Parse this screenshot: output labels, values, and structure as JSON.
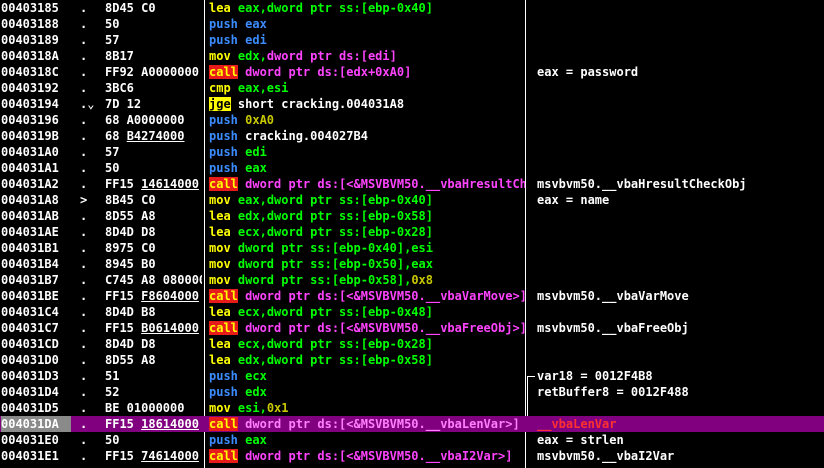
{
  "panel": "Disassembly",
  "rows": [
    {
      "addr": "00403185",
      "mark": ".",
      "bytes": "8D45 C0",
      "ops": [
        {
          "t": "lea",
          "c": "op-yellow"
        },
        {
          "t": " eax,",
          "c": "t-green"
        },
        {
          "t": "dword ptr ss:[ebp-0x40]",
          "c": "t-green"
        }
      ],
      "comment": ""
    },
    {
      "addr": "00403188",
      "mark": ".",
      "bytes": "50",
      "ops": [
        {
          "t": "push",
          "c": "op-blue"
        },
        {
          "t": " eax",
          "c": "op-blue"
        }
      ],
      "comment": ""
    },
    {
      "addr": "00403189",
      "mark": ".",
      "bytes": "57",
      "ops": [
        {
          "t": "push",
          "c": "op-blue"
        },
        {
          "t": " edi",
          "c": "op-blue"
        }
      ],
      "comment": ""
    },
    {
      "addr": "0040318A",
      "mark": ".",
      "bytes": "8B17",
      "ops": [
        {
          "t": "mov",
          "c": "op-yellow"
        },
        {
          "t": " edx,",
          "c": "t-green"
        },
        {
          "t": "dword ptr ds:[edi]",
          "c": "t-magenta"
        }
      ],
      "comment": ""
    },
    {
      "addr": "0040318C",
      "mark": ".",
      "bytes": "FF92 A0000000",
      "ops": [
        {
          "t": "call",
          "c": "op-callbox"
        },
        {
          "t": " dword ptr ds:[edx+0xA0]",
          "c": "t-magenta"
        }
      ],
      "comment": "eax = password"
    },
    {
      "addr": "00403192",
      "mark": ".",
      "bytes": "3BC6",
      "ops": [
        {
          "t": "cmp",
          "c": "op-yellow"
        },
        {
          "t": " eax,esi",
          "c": "t-green"
        }
      ],
      "comment": ""
    },
    {
      "addr": "00403194",
      "mark": ".⌄",
      "bytes": "7D 12",
      "ops": [
        {
          "t": "jge",
          "c": "op-jgebox"
        },
        {
          "t": " short cracking.004031A8",
          "c": "t-white"
        }
      ],
      "comment": ""
    },
    {
      "addr": "00403196",
      "mark": ".",
      "bytes": "68 A0000000",
      "ops": [
        {
          "t": "push",
          "c": "op-blue"
        },
        {
          "t": " 0xA0",
          "c": "t-olive"
        }
      ],
      "comment": ""
    },
    {
      "addr": "0040319B",
      "mark": ".",
      "bytes": "68 B4274000",
      "bytesUl": "B4274000",
      "ops": [
        {
          "t": "push",
          "c": "op-blue"
        },
        {
          "t": " cracking.004027B4",
          "c": "t-white"
        }
      ],
      "comment": ""
    },
    {
      "addr": "004031A0",
      "mark": ".",
      "bytes": "57",
      "ops": [
        {
          "t": "push",
          "c": "op-blue"
        },
        {
          "t": " edi",
          "c": "t-green"
        }
      ],
      "comment": ""
    },
    {
      "addr": "004031A1",
      "mark": ".",
      "bytes": "50",
      "ops": [
        {
          "t": "push",
          "c": "op-blue"
        },
        {
          "t": " eax",
          "c": "t-green"
        }
      ],
      "comment": ""
    },
    {
      "addr": "004031A2",
      "mark": ".",
      "bytes": "FF15 14614000",
      "bytesUl": "14614000",
      "ops": [
        {
          "t": "call",
          "c": "op-callbox"
        },
        {
          "t": " dword ptr ds:[<&MSVBVM50.__vbaHresultCheckObj>]",
          "c": "t-magenta"
        }
      ],
      "comment": "msvbvm50.__vbaHresultCheckObj"
    },
    {
      "addr": "004031A8",
      "mark": ">",
      "bytes": "8B45 C0",
      "ops": [
        {
          "t": "mov",
          "c": "op-yellow"
        },
        {
          "t": " eax,",
          "c": "t-green"
        },
        {
          "t": "dword ptr ss:[ebp-0x40]",
          "c": "t-green"
        }
      ],
      "comment": "eax = name"
    },
    {
      "addr": "004031AB",
      "mark": ".",
      "bytes": "8D55 A8",
      "ops": [
        {
          "t": "lea",
          "c": "op-yellow"
        },
        {
          "t": " edx,",
          "c": "t-green"
        },
        {
          "t": "dword ptr ss:[ebp-0x58]",
          "c": "t-green"
        }
      ],
      "comment": ""
    },
    {
      "addr": "004031AE",
      "mark": ".",
      "bytes": "8D4D D8",
      "ops": [
        {
          "t": "lea",
          "c": "op-yellow"
        },
        {
          "t": " ecx,",
          "c": "t-green"
        },
        {
          "t": "dword ptr ss:[ebp-0x28]",
          "c": "t-green"
        }
      ],
      "comment": ""
    },
    {
      "addr": "004031B1",
      "mark": ".",
      "bytes": "8975 C0",
      "ops": [
        {
          "t": "mov",
          "c": "op-yellow"
        },
        {
          "t": " dword ptr ss:[ebp-0x40],esi",
          "c": "t-green"
        }
      ],
      "comment": ""
    },
    {
      "addr": "004031B4",
      "mark": ".",
      "bytes": "8945 B0",
      "ops": [
        {
          "t": "mov",
          "c": "op-yellow"
        },
        {
          "t": " dword ptr ss:[ebp-0x50],eax",
          "c": "t-green"
        }
      ],
      "comment": ""
    },
    {
      "addr": "004031B7",
      "mark": ".",
      "bytes": "C745 A8 08000000",
      "ops": [
        {
          "t": "mov",
          "c": "op-yellow"
        },
        {
          "t": " dword ptr ss:[ebp-0x58],",
          "c": "t-green"
        },
        {
          "t": "0x8",
          "c": "t-olive"
        }
      ],
      "comment": ""
    },
    {
      "addr": "004031BE",
      "mark": ".",
      "bytes": "FF15 F8604000",
      "bytesUl": "F8604000",
      "ops": [
        {
          "t": "call",
          "c": "op-callbox"
        },
        {
          "t": " dword ptr ds:[<&MSVBVM50.__vbaVarMove>]",
          "c": "t-magenta"
        }
      ],
      "comment": "msvbvm50.__vbaVarMove"
    },
    {
      "addr": "004031C4",
      "mark": ".",
      "bytes": "8D4D B8",
      "ops": [
        {
          "t": "lea",
          "c": "op-yellow"
        },
        {
          "t": " ecx,",
          "c": "t-green"
        },
        {
          "t": "dword ptr ss:[ebp-0x48]",
          "c": "t-green"
        }
      ],
      "comment": ""
    },
    {
      "addr": "004031C7",
      "mark": ".",
      "bytes": "FF15 B0614000",
      "bytesUl": "B0614000",
      "ops": [
        {
          "t": "call",
          "c": "op-callbox"
        },
        {
          "t": " dword ptr ds:[<&MSVBVM50.__vbaFreeObj>]",
          "c": "t-magenta"
        }
      ],
      "comment": "msvbvm50.__vbaFreeObj"
    },
    {
      "addr": "004031CD",
      "mark": ".",
      "bytes": "8D4D D8",
      "ops": [
        {
          "t": "lea",
          "c": "op-yellow"
        },
        {
          "t": " ecx,",
          "c": "t-green"
        },
        {
          "t": "dword ptr ss:[ebp-0x28]",
          "c": "t-green"
        }
      ],
      "comment": ""
    },
    {
      "addr": "004031D0",
      "mark": ".",
      "bytes": "8D55 A8",
      "ops": [
        {
          "t": "lea",
          "c": "op-yellow"
        },
        {
          "t": " edx,",
          "c": "t-green"
        },
        {
          "t": "dword ptr ss:[ebp-0x58]",
          "c": "t-green"
        }
      ],
      "comment": ""
    },
    {
      "addr": "004031D3",
      "mark": ".",
      "bytes": "51",
      "ops": [
        {
          "t": "push",
          "c": "op-blue"
        },
        {
          "t": " ecx",
          "c": "t-green"
        }
      ],
      "comment": "var18 = 0012F4B8"
    },
    {
      "addr": "004031D4",
      "mark": ".",
      "bytes": "52",
      "ops": [
        {
          "t": "push",
          "c": "op-blue"
        },
        {
          "t": " edx",
          "c": "t-green"
        }
      ],
      "comment": "retBuffer8 = 0012F488"
    },
    {
      "addr": "004031D5",
      "mark": ".",
      "bytes": "BE 01000000",
      "ops": [
        {
          "t": "mov",
          "c": "op-yellow"
        },
        {
          "t": " esi,",
          "c": "t-green"
        },
        {
          "t": "0x1",
          "c": "t-olive"
        }
      ],
      "comment": ""
    },
    {
      "addr": "004031DA",
      "mark": ".",
      "bytes": "FF15 18614000",
      "bytesUl": "18614000",
      "ops": [
        {
          "t": "call",
          "c": "op-callbox"
        },
        {
          "t": " dword ptr ds:[<&MSVBVM50.__vbaLenVar>]",
          "c": "t-magenta"
        }
      ],
      "comment": "__vbaLenVar",
      "selected": true
    },
    {
      "addr": "004031E0",
      "mark": ".",
      "bytes": "50",
      "ops": [
        {
          "t": "push",
          "c": "op-blue"
        },
        {
          "t": " eax",
          "c": "t-green"
        }
      ],
      "comment": "eax = strlen"
    },
    {
      "addr": "004031E1",
      "mark": ".",
      "bytes": "FF15 74614000",
      "bytesUl": "74614000",
      "ops": [
        {
          "t": "call",
          "c": "op-callbox"
        },
        {
          "t": " dword ptr ds:[<&MSVBVM50.__vbaI2Var>]",
          "c": "t-magenta"
        }
      ],
      "comment": "msvbvm50.__vbaI2Var"
    }
  ],
  "colors": {
    "background": "#000000",
    "selected_row": "#800080",
    "call_box": "#e81b1b",
    "jge_box": "#ffff00"
  }
}
